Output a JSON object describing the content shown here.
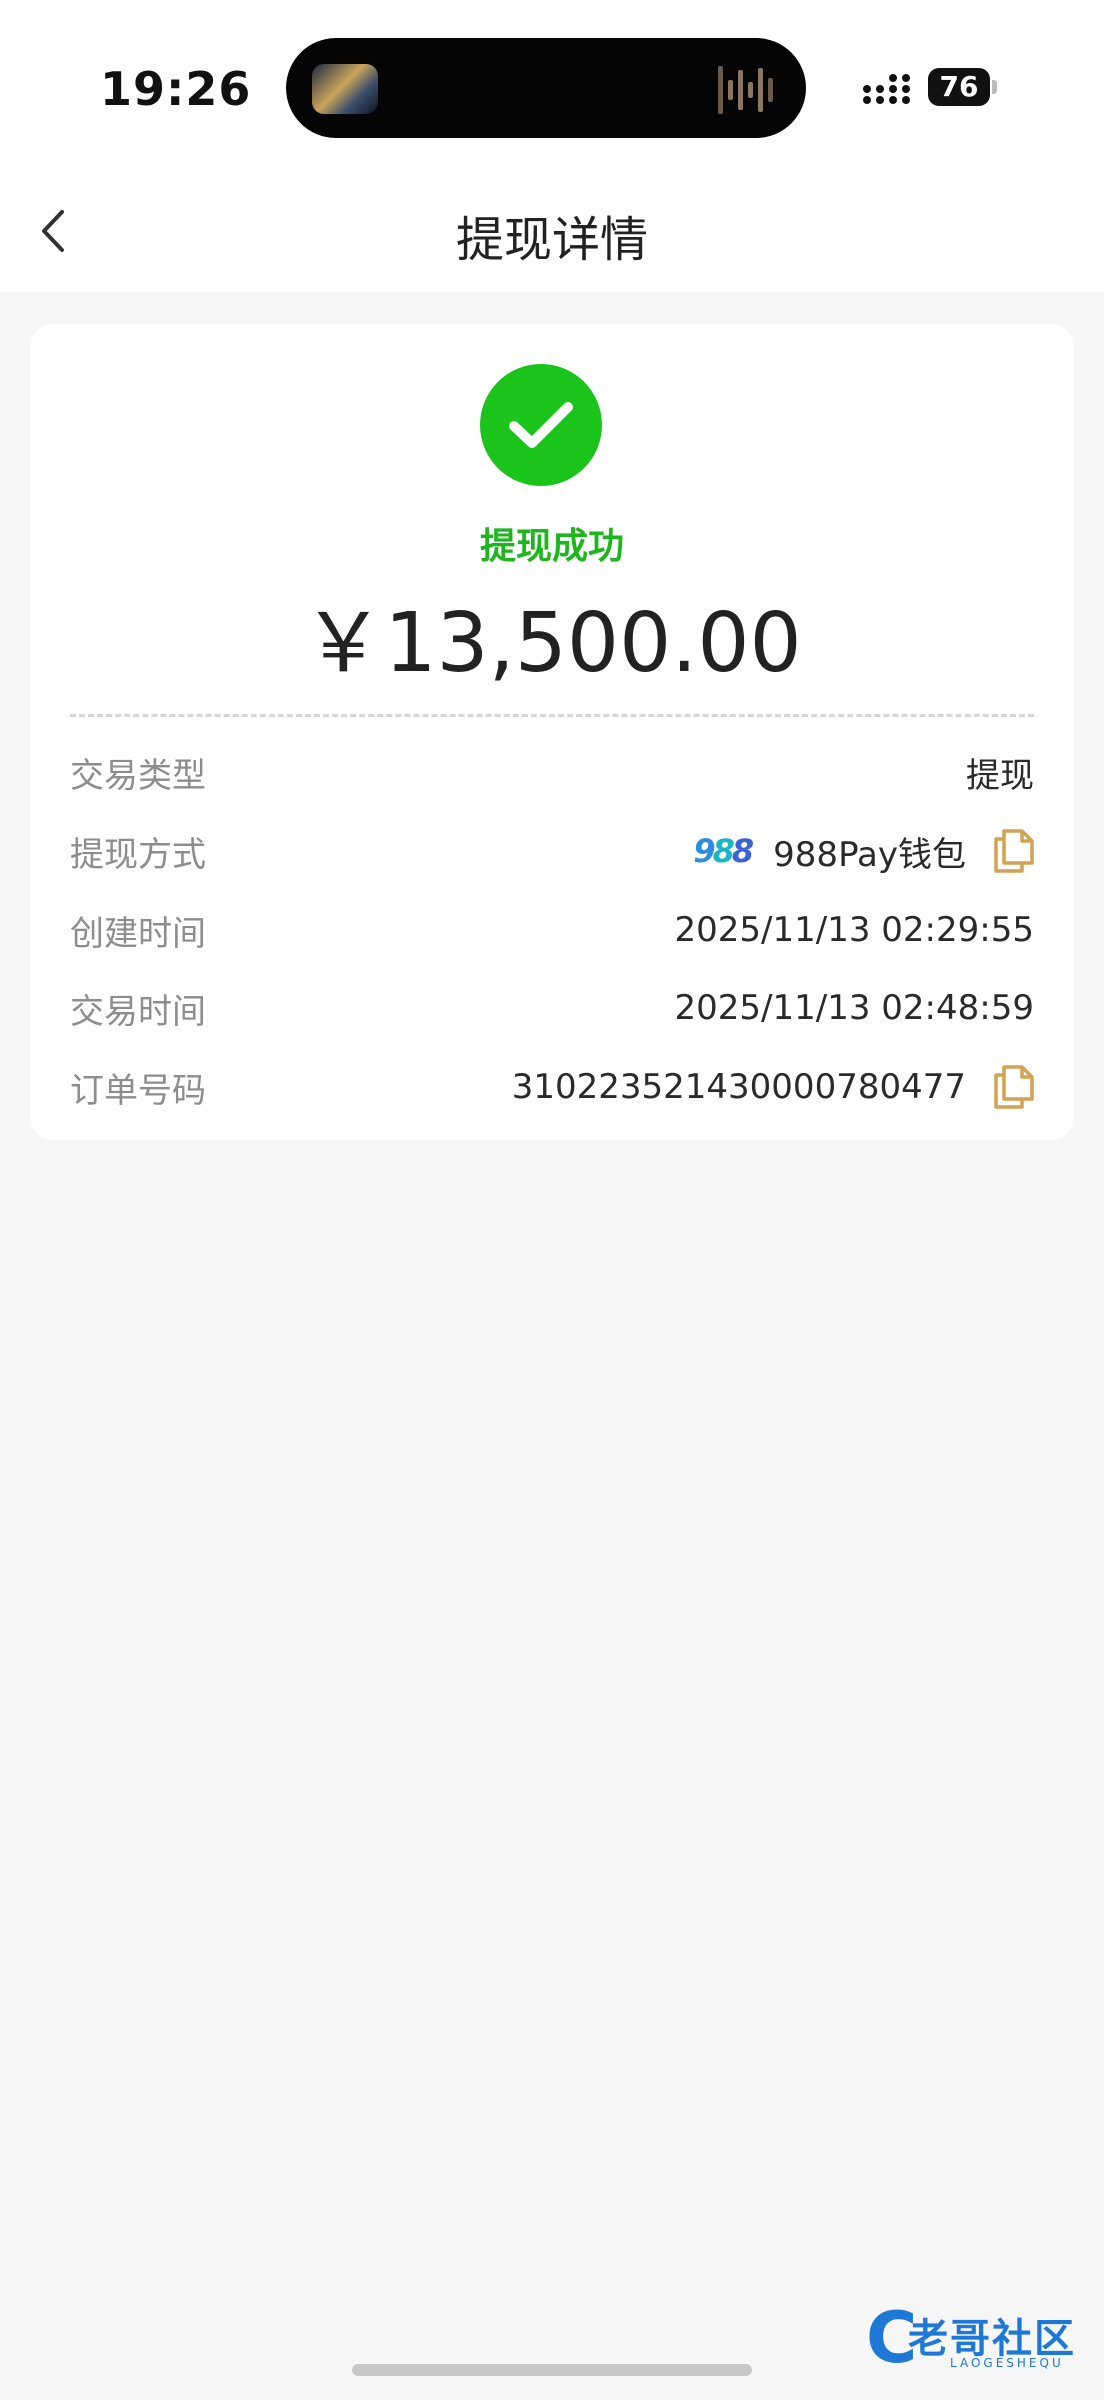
{
  "status_bar": {
    "time": "19:26",
    "battery": "76"
  },
  "nav": {
    "title": "提现详情"
  },
  "card": {
    "status": "提现成功",
    "amount": "￥13,500.00",
    "rows": [
      {
        "label": "交易类型",
        "value": "提现"
      },
      {
        "label": "提现方式",
        "value": "988Pay钱包",
        "logo": "988",
        "copy": true
      },
      {
        "label": "创建时间",
        "value": "2025/11/13 02:29:55"
      },
      {
        "label": "交易时间",
        "value": "2025/11/13 02:48:59"
      },
      {
        "label": "订单号码",
        "value": "31022352143000078047 7",
        "copy": true
      }
    ]
  },
  "watermark": {
    "title": "老哥社区",
    "sub": "LAOGESHEQU"
  },
  "colors": {
    "success": "#1bc41b",
    "copy_icon": "#d2a451",
    "logo_blue": "#2b8de0"
  },
  "icons": [
    "back-chevron-icon",
    "check-icon",
    "copy-icon",
    "signal-icon",
    "battery-icon"
  ]
}
